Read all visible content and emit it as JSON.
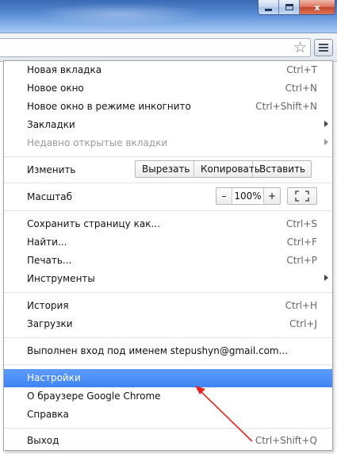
{
  "window": {
    "close_glyph": "x"
  },
  "toolbar": {
    "star_icon": "star-icon",
    "menu_icon": "hamburger-menu-icon"
  },
  "menu": {
    "group1": [
      {
        "label": "Новая вкладка",
        "shortcut": "Ctrl+T"
      },
      {
        "label": "Новое окно",
        "shortcut": "Ctrl+N"
      },
      {
        "label": "Новое окно в режиме инкогнито",
        "shortcut": "Ctrl+Shift+N"
      },
      {
        "label": "Закладки",
        "shortcut": ""
      },
      {
        "label": "Недавно открытые вкладки",
        "shortcut": ""
      }
    ],
    "edit": {
      "label": "Изменить",
      "cut": "Вырезать",
      "copy": "Копировать",
      "paste": "Вставить"
    },
    "zoom": {
      "label": "Масштаб",
      "minus": "–",
      "value": "100%",
      "plus": "+"
    },
    "group2": [
      {
        "label": "Сохранить страницу как...",
        "shortcut": "Ctrl+S"
      },
      {
        "label": "Найти...",
        "shortcut": "Ctrl+F"
      },
      {
        "label": "Печать...",
        "shortcut": "Ctrl+P"
      },
      {
        "label": "Инструменты",
        "shortcut": ""
      }
    ],
    "group3": [
      {
        "label": "История",
        "shortcut": "Ctrl+H"
      },
      {
        "label": "Загрузки",
        "shortcut": "Ctrl+J"
      }
    ],
    "signed_in": "Выполнен вход под именем stepushyn@gmail.com...",
    "group4": [
      {
        "label": "Настройки",
        "shortcut": ""
      },
      {
        "label": "О браузере Google Chrome",
        "shortcut": ""
      },
      {
        "label": "Справка",
        "shortcut": ""
      }
    ],
    "exit": {
      "label": "Выход",
      "shortcut": "Ctrl+Shift+Q"
    },
    "selected_item": "Настройки",
    "highlight_color": "#4d90fe"
  },
  "annotation": {
    "arrow_color": "#e8221c"
  }
}
